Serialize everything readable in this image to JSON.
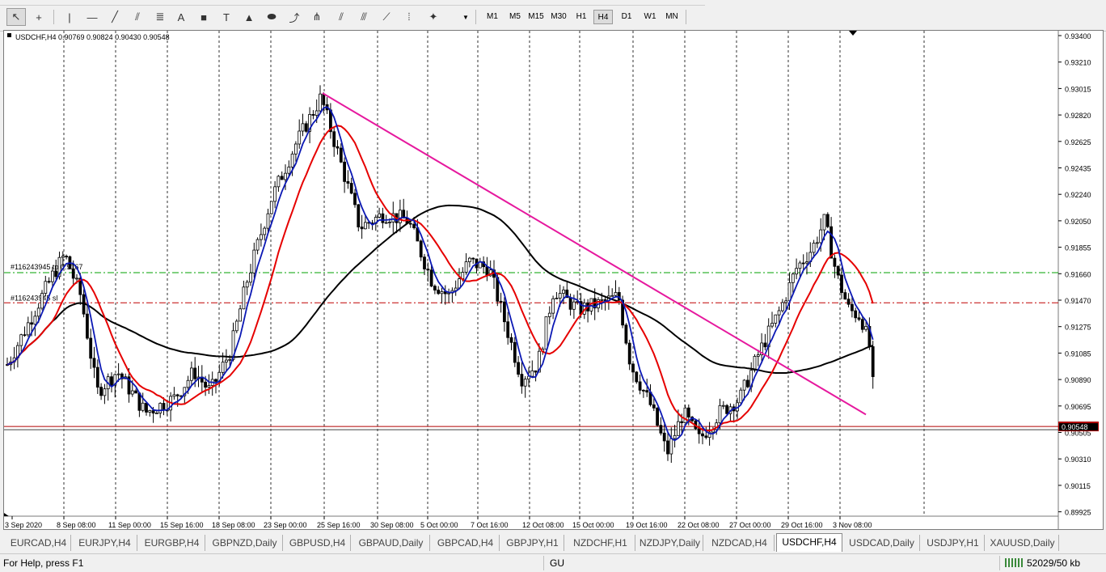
{
  "toolbar": {
    "tools": [
      {
        "name": "cursor-icon",
        "glyph": "↖",
        "selected": true
      },
      {
        "name": "crosshair-icon",
        "glyph": "+",
        "selected": false
      },
      {
        "name": "vertical-line-icon",
        "glyph": "|",
        "selected": false
      },
      {
        "name": "horizontal-line-icon",
        "glyph": "—",
        "selected": false
      },
      {
        "name": "trendline-icon",
        "glyph": "╱",
        "selected": false
      },
      {
        "name": "equidistant-channel-icon",
        "glyph": "⫽",
        "selected": false
      },
      {
        "name": "fibonacci-retracement-icon",
        "glyph": "≣",
        "selected": false
      },
      {
        "name": "text-icon",
        "glyph": "A",
        "selected": false
      },
      {
        "name": "rectangle-icon",
        "glyph": "■",
        "selected": false
      },
      {
        "name": "text-label-icon",
        "glyph": "T",
        "selected": false
      },
      {
        "name": "triangle-icon",
        "glyph": "▲",
        "selected": false
      },
      {
        "name": "ellipse-icon",
        "glyph": "⬬",
        "selected": false
      },
      {
        "name": "arrow-icon",
        "glyph": "⤴",
        "selected": false
      },
      {
        "name": "andrews-pitchfork-icon",
        "glyph": "⋔",
        "selected": false
      },
      {
        "name": "parallel-lines-icon",
        "glyph": "⫽",
        "selected": false
      },
      {
        "name": "gann-line-icon",
        "glyph": "⫻",
        "selected": false
      },
      {
        "name": "fibonacci-fan-icon",
        "glyph": "⟋",
        "selected": false
      },
      {
        "name": "fibonacci-time-zones-icon",
        "glyph": "⦙",
        "selected": false
      },
      {
        "name": "price-label-icon",
        "glyph": "✦",
        "selected": false
      }
    ],
    "timeframes": [
      "M1",
      "M5",
      "M15",
      "M30",
      "H1",
      "H4",
      "D1",
      "W1",
      "MN"
    ],
    "active_timeframe": "H4"
  },
  "chart": {
    "header": "USDCHF,H4  0.90769 0.90824 0.90430 0.90548",
    "current_price": "0.90548",
    "order_labels": [
      "#116243945 tp 0.9167",
      "#116243945 sl"
    ],
    "y_axis_labels": [
      "0.93400",
      "0.93210",
      "0.93015",
      "0.92820",
      "0.92625",
      "0.92435",
      "0.92240",
      "0.92050",
      "0.91855",
      "0.91660",
      "0.91470",
      "0.91275",
      "0.91085",
      "0.90890",
      "0.90695",
      "0.90505",
      "0.90310",
      "0.90115",
      "0.89925"
    ],
    "x_axis_labels": [
      "3 Sep 2020",
      "8 Sep 08:00",
      "11 Sep 00:00",
      "15 Sep 16:00",
      "18 Sep 08:00",
      "23 Sep 00:00",
      "25 Sep 16:00",
      "30 Sep 08:00",
      "5 Oct 00:00",
      "7 Oct 16:00",
      "12 Oct 08:00",
      "15 Oct 00:00",
      "19 Oct 16:00",
      "22 Oct 08:00",
      "27 Oct 00:00",
      "29 Oct 16:00",
      "3 Nov 08:00"
    ],
    "colors": {
      "fast_ma": "#0b18b4",
      "slow_ma": "#e60000",
      "long_ma": "#000000",
      "trendline": "#e6199e",
      "tp_line": "#00a000",
      "sl_line": "#c00000",
      "price_line": "#b00000"
    }
  },
  "tabs": {
    "items": [
      "EURCAD,H4",
      "EURJPY,H4",
      "EURGBP,H4",
      "GBPNZD,Daily",
      "GBPUSD,H4",
      "GBPAUD,Daily",
      "GBPCAD,H4",
      "GBPJPY,H1",
      "NZDCHF,H1",
      "NZDJPY,Daily",
      "NZDCAD,H4",
      "USDCHF,H4",
      "USDCAD,Daily",
      "USDJPY,H1",
      "XAUUSD,Daily"
    ],
    "active": "USDCHF,H4"
  },
  "status": {
    "help": "For Help, press F1",
    "profile": "GU",
    "connection": "52029/50 kb"
  }
}
